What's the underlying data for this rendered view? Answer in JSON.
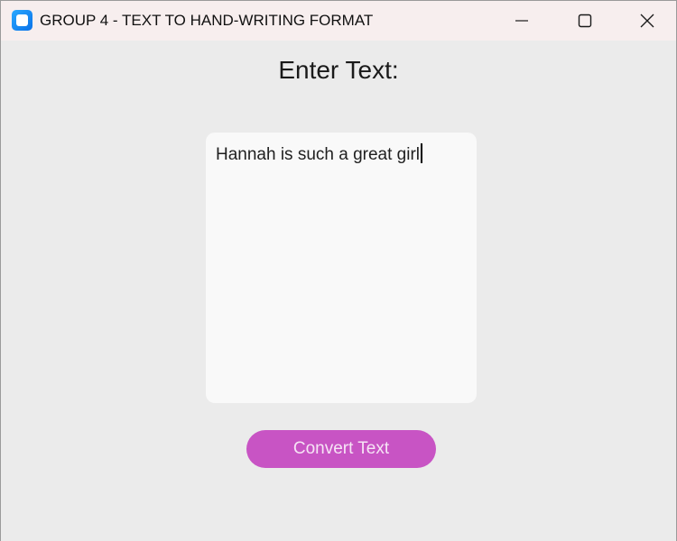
{
  "window": {
    "title": "GROUP 4 - TEXT TO HAND-WRITING FORMAT",
    "icon": "app-icon",
    "controls": [
      "minimize-icon",
      "maximize-icon",
      "close-icon"
    ]
  },
  "main": {
    "heading": "Enter Text:",
    "text_input": {
      "value": "Hannah is such a great girl"
    },
    "convert_button_label": "Convert Text"
  },
  "colors": {
    "titlebar_bg": "#f7eeee",
    "window_bg": "#ebebeb",
    "textbox_bg": "#f9f9f9",
    "button_bg": "#c854c4",
    "button_text": "#f6e4f5"
  }
}
